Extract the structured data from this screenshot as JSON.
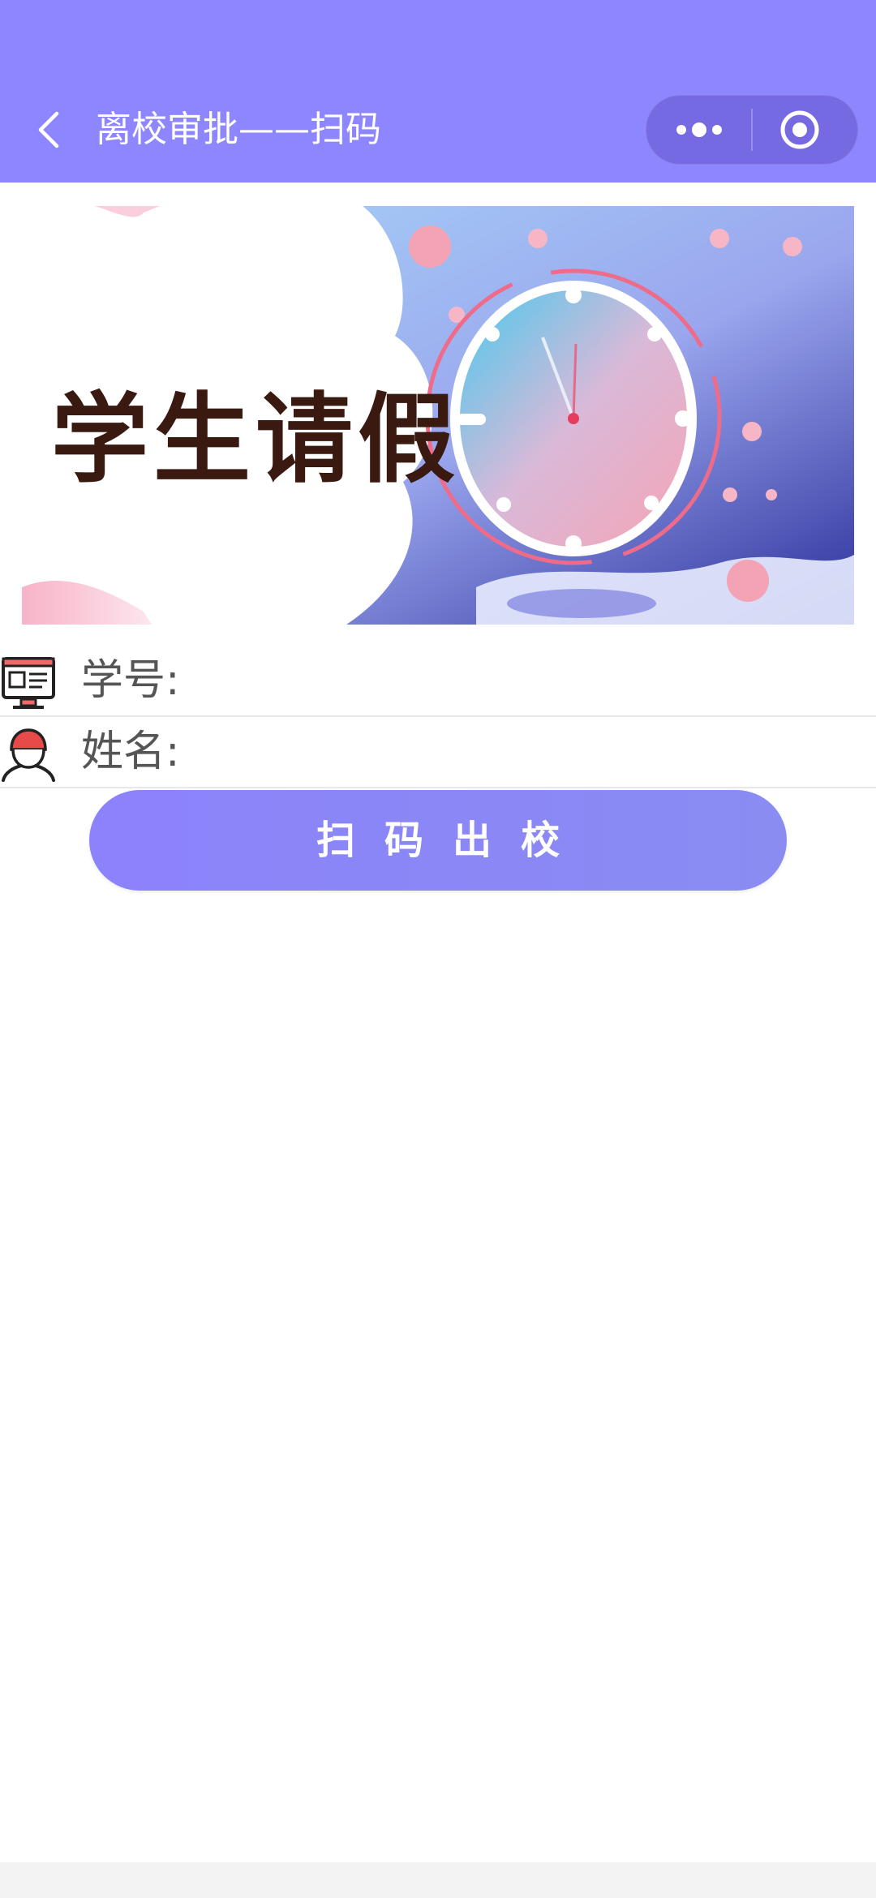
{
  "header": {
    "title": "离校审批——扫码",
    "back_icon": "chevron-left-icon",
    "menu_icon": "more-dots-icon",
    "close_icon": "target-circle-icon",
    "background": "#8e86ff"
  },
  "banner": {
    "text": "学生请假"
  },
  "form": {
    "student_id_label": "学号:",
    "student_id_value": "",
    "name_label": "姓名:",
    "name_value": ""
  },
  "button": {
    "label": "扫码出校"
  }
}
